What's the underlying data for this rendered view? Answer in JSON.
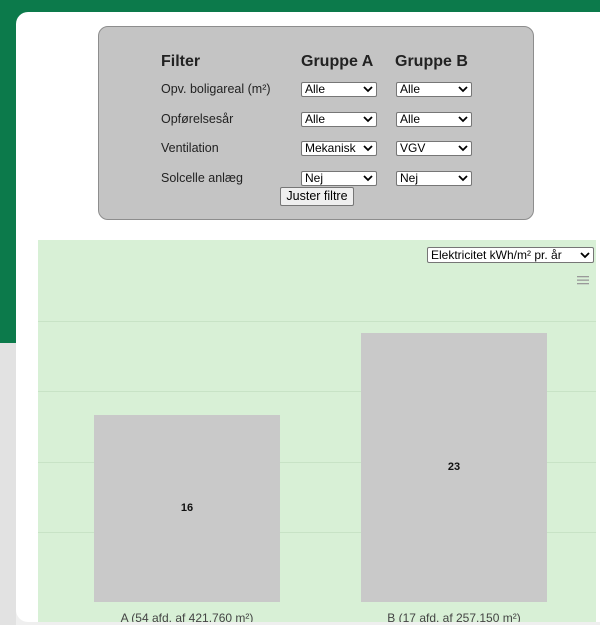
{
  "filter": {
    "title": "Filter",
    "group_a_header": "Gruppe A",
    "group_b_header": "Gruppe B",
    "rows": [
      {
        "label": "Opv. boligareal (m²)",
        "group_a": "Alle",
        "group_b": "Alle"
      },
      {
        "label": "Opførelsesår",
        "group_a": "Alle",
        "group_b": "Alle"
      },
      {
        "label": "Ventilation",
        "group_a": "Mekanisk",
        "group_b": "VGV"
      },
      {
        "label": "Solcelle anlæg",
        "group_a": "Nej",
        "group_b": "Nej"
      }
    ],
    "apply_button": "Juster filtre"
  },
  "chart_controls": {
    "metric_select": "Elektricitet kWh/m² pr. år",
    "menu_icon": "hamburger-menu-icon"
  },
  "chart_data": {
    "type": "bar",
    "categories": [
      "A (54 afd. af 421.760 m²)",
      "B (17 afd. af 257.150 m²)"
    ],
    "values": [
      16,
      23
    ],
    "ylim": [
      0,
      27
    ],
    "grid": true,
    "colors": {
      "bar": "#c9c9c9",
      "background": "#d8f0d6"
    }
  },
  "colors": {
    "brand_green": "#0c7a4b",
    "panel_gray": "#c4c4c4"
  }
}
